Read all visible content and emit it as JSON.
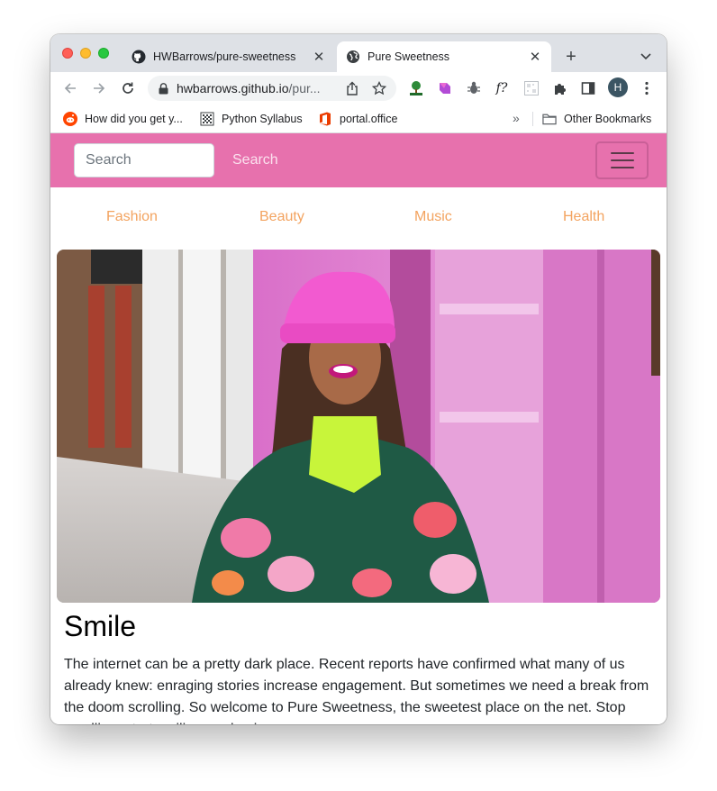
{
  "browser": {
    "tabs": [
      {
        "title": "HWBarrows/pure-sweetness",
        "favicon": "github-icon",
        "active": false
      },
      {
        "title": "Pure Sweetness",
        "favicon": "globe-icon",
        "active": true
      }
    ],
    "new_tab_label": "+",
    "address": {
      "host": "hwbarrows.github.io",
      "path": "/pur..."
    },
    "avatar_initial": "H",
    "extensions": [
      "tree-extension-icon",
      "color-extension-icon",
      "bug-extension-icon",
      "fx-extension-icon",
      "qr-extension-icon",
      "puzzle-icon",
      "sidebar-icon"
    ],
    "fx_label": "f?"
  },
  "bookmarks": {
    "items": [
      {
        "label": "How did you get y...",
        "icon": "reddit-icon"
      },
      {
        "label": "Python Syllabus",
        "icon": "syllabus-icon"
      },
      {
        "label": "portal.office",
        "icon": "office-icon"
      }
    ],
    "more_label": "»",
    "other_label": "Other Bookmarks"
  },
  "site": {
    "search_placeholder": "Search",
    "search_button": "Search",
    "categories": [
      "Fashion",
      "Beauty",
      "Music",
      "Health"
    ],
    "headline": "Smile",
    "body": "The internet can be a pretty dark place. Recent reports have confirmed what many of us already knew: enraging stories increase engagement. But sometimes we need a break from the doom scrolling. So welcome to Pure Sweetness, the sweetest place on the net. Stop scrolling, start smiling, and enjoy.",
    "colors": {
      "navbar": "#e771ad",
      "category_link": "#f3a35f"
    }
  }
}
